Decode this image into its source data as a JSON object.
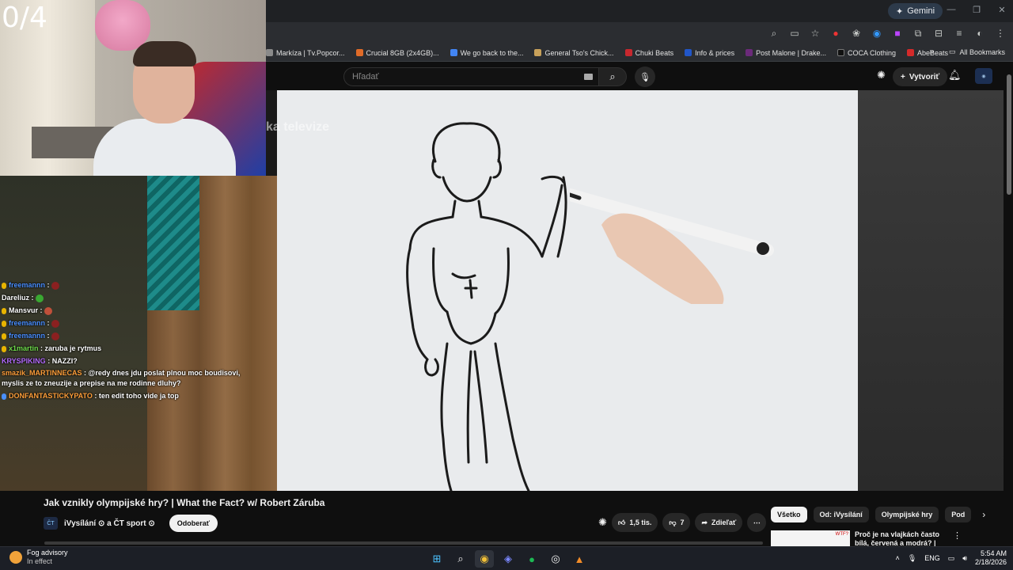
{
  "overlay": {
    "counter": "0/4",
    "bg_text": "ka televize"
  },
  "browser": {
    "gemini_label": "Gemini",
    "bookmarks": [
      {
        "label": "Markíza | Tv.Popcor...",
        "color": "#8a8a8a"
      },
      {
        "label": "Crucial 8GB (2x4GB)...",
        "color": "#e06b28"
      },
      {
        "label": "We go back to the...",
        "color": "#4285f4"
      },
      {
        "label": "General Tso's Chick...",
        "color": "#c8a15a"
      },
      {
        "label": "Chuki Beats",
        "color": "#c7282e"
      },
      {
        "label": "Info & prices",
        "color": "#2156c8"
      },
      {
        "label": "Post Malone | Drake...",
        "color": "#6b2a7a"
      },
      {
        "label": "COCA Clothing",
        "color": "#111111"
      },
      {
        "label": "AbeBeats",
        "color": "#d42a2a"
      }
    ],
    "all_bookmarks": "All Bookmarks"
  },
  "youtube": {
    "search_placeholder": "Hľadať",
    "create_label": "Vytvoriť",
    "video_title": "Jak vznikly olympijské hry? | What the Fact? w/ Robert Záruba",
    "channel_name": "iVysílání ⊙ a ČT sport ⊙",
    "subscribe_label": "Odoberať",
    "likes": "1,5 tis.",
    "dislikes": "7",
    "share_label": "Zdieľať",
    "chips": [
      "Všetko",
      "Od: iVysílání",
      "Olympijské hry",
      "Pod"
    ],
    "rec_title": "Proč je na vlajkách často bílá, červená a modrá? | What the",
    "rec_thumb_text": "WTF?"
  },
  "chat": [
    {
      "user": "freemannn",
      "color": "#4a8fff",
      "msg": ":",
      "badge": true,
      "emote": "#8b2020"
    },
    {
      "user": "Dareliuz",
      "color": "#ffffff",
      "msg": ":",
      "badge": false,
      "emote": "#3aa832"
    },
    {
      "user": "Mansvur",
      "color": "#ffffff",
      "msg": ":",
      "badge": true,
      "emote": "#c0503a"
    },
    {
      "user": "freemannn",
      "color": "#4a8fff",
      "msg": ":",
      "badge": true,
      "emote": "#8b2020"
    },
    {
      "user": "freemannn",
      "color": "#4a8fff",
      "msg": ":",
      "badge": true,
      "emote": "#8b2020"
    },
    {
      "user": "x1martin",
      "color": "#6fdc4c",
      "msg": ": zaruba je rytmus",
      "badge": true,
      "emote": ""
    },
    {
      "user": "KRYSPIKING",
      "color": "#b56cff",
      "msg": ": NAZZI?",
      "badge": false,
      "emote": ""
    },
    {
      "user": "smazik_MARTINNECAS",
      "color": "#ff9f3a",
      "msg": ": @redy dnes jdu poslat plnou moc boudisovi, myslis ze to zneuzije a prepise na me rodinne dluhy?",
      "badge": false,
      "emote": ""
    },
    {
      "user": "DONFANTASTICKYPATO",
      "color": "#ff9f3a",
      "msg": ": ten edit toho vide ja top",
      "badge": true,
      "emote": ""
    }
  ],
  "taskbar": {
    "weather_title": "Fog advisory",
    "weather_sub": "In effect",
    "badge_count": "1",
    "discord_badge": "9+",
    "lang": "ENG",
    "time": "5:54 AM",
    "date": "2/18/2026"
  }
}
